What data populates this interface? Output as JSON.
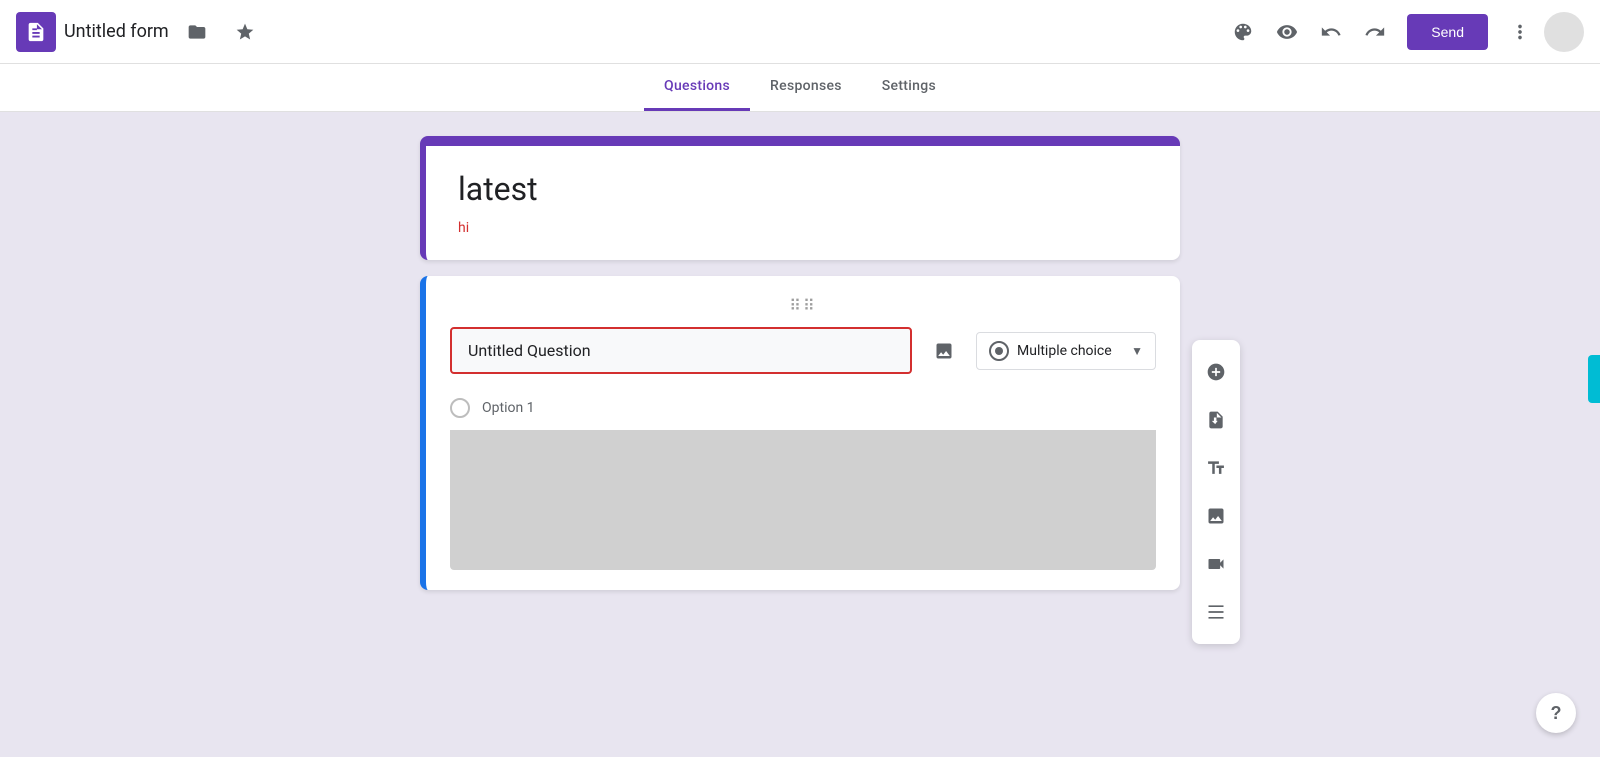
{
  "header": {
    "app_name": "Untitled form",
    "folder_icon": "folder-icon",
    "star_icon": "star-icon",
    "palette_icon": "palette-icon",
    "preview_icon": "preview-icon",
    "undo_icon": "undo-icon",
    "redo_icon": "redo-icon",
    "send_label": "Send",
    "more_icon": "more-icon"
  },
  "tabs": [
    {
      "label": "Questions",
      "active": true
    },
    {
      "label": "Responses",
      "active": false
    },
    {
      "label": "Settings",
      "active": false
    }
  ],
  "form_card": {
    "title": "latest",
    "description": "hi"
  },
  "question_card": {
    "drag_handle": "⠿",
    "question_placeholder": "Untitled Question",
    "question_value": "Untitled Question",
    "type_label": "Multiple choice",
    "option_label": "Option 1"
  },
  "sidebar_tools": [
    {
      "icon": "add-circle-icon",
      "label": "Add question"
    },
    {
      "icon": "import-icon",
      "label": "Import questions"
    },
    {
      "icon": "title-icon",
      "label": "Add title and description"
    },
    {
      "icon": "image-icon",
      "label": "Add image"
    },
    {
      "icon": "video-icon",
      "label": "Add video"
    },
    {
      "icon": "section-icon",
      "label": "Add section"
    }
  ],
  "colors": {
    "accent": "#673ab7",
    "border_active": "#1a73e8",
    "error": "#d32f2f",
    "bg": "#e8e5f0"
  }
}
